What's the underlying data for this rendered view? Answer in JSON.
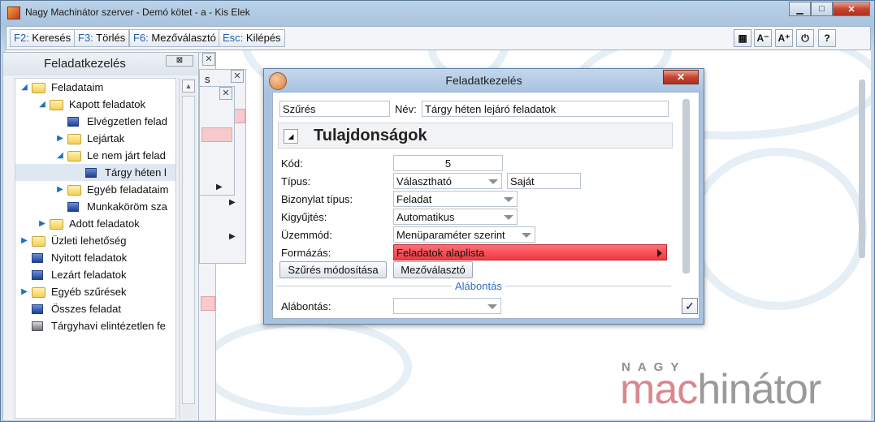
{
  "window": {
    "title": "Nagy Machinátor szerver - Demó kötet - a - Kis Elek",
    "minimize": "▁",
    "maximize": "□",
    "close": "✕"
  },
  "toolbar": {
    "buttons": [
      {
        "key": "F2:",
        "label": " Keresés"
      },
      {
        "key": "F3:",
        "label": " Törlés"
      },
      {
        "key": "F6:",
        "label": " Mezőválasztó"
      },
      {
        "key": "Esc:",
        "label": " Kilépés"
      }
    ],
    "icons": [
      {
        "name": "layout-grid-icon",
        "glyph": "▦"
      },
      {
        "name": "font-decrease-icon",
        "glyph": "A⁻"
      },
      {
        "name": "font-increase-icon",
        "glyph": "A⁺"
      },
      {
        "name": "logout-icon",
        "glyph": "⏻"
      },
      {
        "name": "help-icon",
        "glyph": "?"
      }
    ]
  },
  "left_panel": {
    "title": "Feladatkezelés",
    "pin": "⊠",
    "tree": [
      {
        "label": "Feladataim",
        "indent": 0,
        "icon": "folder",
        "expander": "◢"
      },
      {
        "label": "Kapott feladatok",
        "indent": 1,
        "icon": "folder",
        "expander": "◢"
      },
      {
        "label": "Elvégzetlen felad",
        "indent": 2,
        "icon": "doc",
        "expander": ""
      },
      {
        "label": "Lejártak",
        "indent": 2,
        "icon": "folder",
        "expander": "▶"
      },
      {
        "label": "Le nem járt felad",
        "indent": 2,
        "icon": "folder",
        "expander": "◢"
      },
      {
        "label": "Tárgy héten l",
        "indent": 3,
        "icon": "doc",
        "expander": "",
        "selected": true
      },
      {
        "label": "Egyéb feladataim",
        "indent": 2,
        "icon": "folder",
        "expander": "▶"
      },
      {
        "label": "Munkaköröm sza",
        "indent": 2,
        "icon": "doc",
        "expander": ""
      },
      {
        "label": "Adott feladatok",
        "indent": 1,
        "icon": "folder",
        "expander": "▶"
      },
      {
        "label": "Üzleti lehetőség",
        "indent": 0,
        "icon": "folder",
        "expander": "▶"
      },
      {
        "label": "Nyitott feladatok",
        "indent": 0,
        "icon": "doc",
        "expander": ""
      },
      {
        "label": "Lezárt feladatok",
        "indent": 0,
        "icon": "doc",
        "expander": ""
      },
      {
        "label": "Egyéb szűrések",
        "indent": 0,
        "icon": "folder",
        "expander": "▶"
      },
      {
        "label": "Összes feladat",
        "indent": 0,
        "icon": "doc",
        "expander": ""
      },
      {
        "label": "Tárgyhavi elintézetlen fe",
        "indent": 0,
        "icon": "printer",
        "expander": ""
      }
    ]
  },
  "bg_panel": {
    "tab_fragment": "s"
  },
  "dialog": {
    "title": "Feladatkezelés",
    "close": "✕",
    "szures_label": "Szűrés",
    "nev_label": "Név:",
    "nev_value": "Tárgy héten lejáró feladatok",
    "section_title": "Tulajdonságok",
    "kod_label": "Kód:",
    "kod_value": "5",
    "tipus_label": "Típus:",
    "tipus_value": "Választható",
    "tipus_extra": "Saját",
    "bizonylat_label": "Bizonylat típus:",
    "bizonylat_value": "Feladat",
    "kigyujtes_label": "Kigyűjtés:",
    "kigyujtes_value": "Automatikus",
    "uzemmod_label": "Üzemmód:",
    "uzemmod_value": "Menüparaméter szerint",
    "formazas_label": "Formázás:",
    "formazas_value": "Feladatok alaplista",
    "btn_szures_mod": "Szűrés módosítása",
    "btn_mezovalaszto": "Mezőválasztó",
    "alabontas_group": "Alábontás",
    "alabontas_label": "Alábontás:",
    "alabontas_value": "",
    "ok": "✓"
  },
  "branding": {
    "top": "NAGY",
    "accent": "mac",
    "rest": "hinátor"
  }
}
